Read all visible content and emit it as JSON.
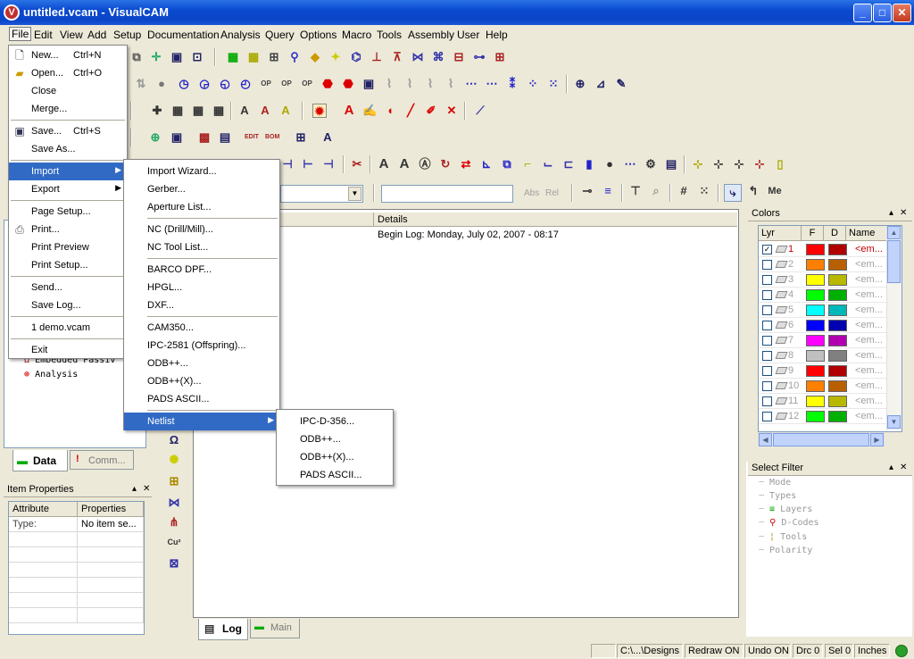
{
  "window": {
    "title": "untitled.vcam - VisualCAM",
    "app_icon_letter": "V",
    "minimize": "_",
    "maximize": "□",
    "close": "✕"
  },
  "menubar": {
    "items": [
      "File",
      "Edit",
      "View",
      "Add",
      "Setup",
      "Documentation",
      "Analysis",
      "Query",
      "Options",
      "Macro",
      "Tools",
      "Assembly",
      "User",
      "Help"
    ]
  },
  "file_menu": {
    "items": [
      {
        "label": "New...",
        "shortcut": "Ctrl+N",
        "icon": "new-document-icon"
      },
      {
        "label": "Open...",
        "shortcut": "Ctrl+O",
        "icon": "open-folder-icon"
      },
      {
        "label": "Close",
        "shortcut": ""
      },
      {
        "label": "Merge...",
        "shortcut": ""
      },
      {
        "label": "Save...",
        "shortcut": "Ctrl+S",
        "icon": "save-disk-icon"
      },
      {
        "label": "Save As...",
        "shortcut": ""
      },
      {
        "label": "Import",
        "shortcut": "",
        "submenu": true
      },
      {
        "label": "Export",
        "shortcut": "",
        "submenu": true
      },
      {
        "label": "Page Setup...",
        "shortcut": ""
      },
      {
        "label": "Print...",
        "shortcut": "",
        "icon": "printer-icon"
      },
      {
        "label": "Print Preview",
        "shortcut": ""
      },
      {
        "label": "Print Setup...",
        "shortcut": ""
      },
      {
        "label": "Send...",
        "shortcut": ""
      },
      {
        "label": "Save Log...",
        "shortcut": ""
      },
      {
        "label": "1 demo.vcam",
        "shortcut": ""
      },
      {
        "label": "Exit",
        "shortcut": ""
      }
    ]
  },
  "import_menu": {
    "items": [
      {
        "label": "Import Wizard..."
      },
      {
        "label": "Gerber..."
      },
      {
        "label": "Aperture List..."
      },
      {
        "label": "NC (Drill/Mill)..."
      },
      {
        "label": "NC Tool List..."
      },
      {
        "label": "BARCO DPF..."
      },
      {
        "label": "HPGL..."
      },
      {
        "label": "DXF..."
      },
      {
        "label": "CAM350..."
      },
      {
        "label": "IPC-2581 (Offspring)..."
      },
      {
        "label": "ODB++..."
      },
      {
        "label": "ODB++(X)..."
      },
      {
        "label": "PADS ASCII..."
      },
      {
        "label": "Netlist"
      }
    ]
  },
  "netlist_menu": {
    "items": [
      {
        "label": "IPC-D-356..."
      },
      {
        "label": "ODB++..."
      },
      {
        "label": "ODB++(X)..."
      },
      {
        "label": "PADS ASCII..."
      }
    ]
  },
  "toolbar": {
    "abs_label": "Abs",
    "rel_label": "Rel",
    "me_label": "Me",
    "coord_value": "",
    "layer_combo_value": ""
  },
  "left_panel": {
    "tree": [
      {
        "label": "Embedded Passiv",
        "icon": "embedded-passive-icon"
      },
      {
        "label": "Analysis",
        "icon": "analysis-icon"
      }
    ],
    "tabs": [
      {
        "label": "Data",
        "icon": "data-board-icon"
      },
      {
        "label": "Comm...",
        "icon": "comment-icon"
      }
    ]
  },
  "item_properties": {
    "title": "Item Properties",
    "columns": [
      "Attribute",
      "Properties"
    ],
    "rows": [
      {
        "attribute": "Type:",
        "property": "No item se..."
      }
    ]
  },
  "log": {
    "column_header": "Details",
    "entries": [
      "Begin Log: Monday, July 02, 2007 - 08:17"
    ],
    "tabs": [
      {
        "label": "Log",
        "icon": "log-icon"
      },
      {
        "label": "Main",
        "icon": "main-board-icon"
      }
    ]
  },
  "colors_panel": {
    "title": "Colors",
    "columns": [
      "Lyr",
      "F",
      "D",
      "Name"
    ],
    "layers": [
      {
        "num": "1",
        "checked": true,
        "flash": "#ff0000",
        "draw": "#b00000",
        "name": "<em...",
        "active": true
      },
      {
        "num": "2",
        "checked": false,
        "flash": "#ff8000",
        "draw": "#b86000",
        "name": "<em..."
      },
      {
        "num": "3",
        "checked": false,
        "flash": "#ffff00",
        "draw": "#b8b800",
        "name": "<em..."
      },
      {
        "num": "4",
        "checked": false,
        "flash": "#00ff00",
        "draw": "#00b000",
        "name": "<em..."
      },
      {
        "num": "5",
        "checked": false,
        "flash": "#00ffff",
        "draw": "#00b8b8",
        "name": "<em..."
      },
      {
        "num": "6",
        "checked": false,
        "flash": "#0000ff",
        "draw": "#0000b0",
        "name": "<em..."
      },
      {
        "num": "7",
        "checked": false,
        "flash": "#ff00ff",
        "draw": "#b000b0",
        "name": "<em..."
      },
      {
        "num": "8",
        "checked": false,
        "flash": "#c0c0c0",
        "draw": "#808080",
        "name": "<em..."
      },
      {
        "num": "9",
        "checked": false,
        "flash": "#ff0000",
        "draw": "#b00000",
        "name": "<em..."
      },
      {
        "num": "10",
        "checked": false,
        "flash": "#ff8000",
        "draw": "#b86000",
        "name": "<em..."
      },
      {
        "num": "11",
        "checked": false,
        "flash": "#ffff00",
        "draw": "#b8b800",
        "name": "<em..."
      },
      {
        "num": "12",
        "checked": false,
        "flash": "#00ff00",
        "draw": "#00b000",
        "name": "<em..."
      }
    ]
  },
  "select_filter": {
    "title": "Select Filter",
    "items": [
      {
        "label": "Mode",
        "icon": ""
      },
      {
        "label": "Types",
        "icon": ""
      },
      {
        "label": "Layers",
        "icon": "layers-icon"
      },
      {
        "label": "D-Codes",
        "icon": "dcodes-icon"
      },
      {
        "label": "Tools",
        "icon": "tools-icon"
      },
      {
        "label": "Polarity",
        "icon": ""
      }
    ]
  },
  "statusbar": {
    "path": "C:\\...\\Designs",
    "redraw": "Redraw ON",
    "undo": "Undo ON",
    "drc": "Drc 0",
    "sel": "Sel 0",
    "units": "Inches"
  }
}
